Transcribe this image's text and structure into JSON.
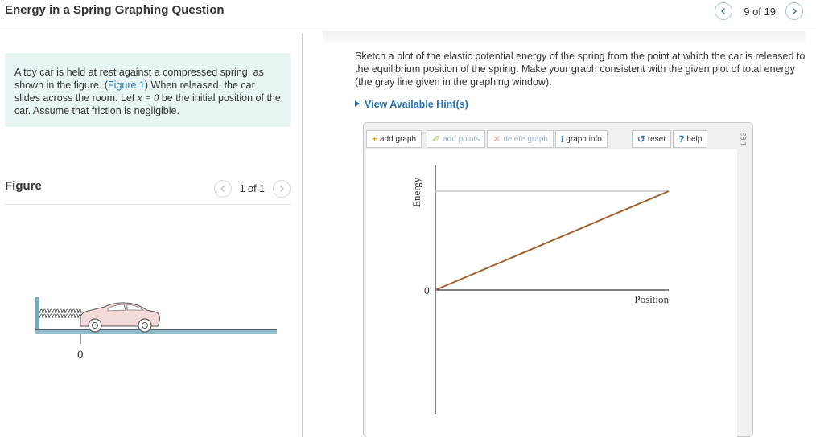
{
  "header": {
    "title": "Energy in a Spring Graphing Question",
    "position": "9 of 19"
  },
  "problem": {
    "part1": "A toy car is held at rest against a compressed spring, as shown in the figure. (",
    "figure_link": "Figure 1",
    "part2": ") When released, the car slides across the room. Let ",
    "math": "x = 0",
    "part3": " be the initial position of the car. Assume that friction is negligible."
  },
  "figure_panel": {
    "title": "Figure",
    "position": "1 of 1",
    "axis_label": "0"
  },
  "question": {
    "prompt": "Sketch a plot of the elastic potential energy of the spring from the point at which the car is released to the equilibrium position of the spring. Make your graph consistent with the given plot of total energy (the gray line given in the graphing window).",
    "hints_label": "View Available Hint(s)"
  },
  "toolbar": {
    "add_graph": "add graph",
    "add_points": "add points",
    "delete_graph": "delete graph",
    "graph_info": "graph info",
    "reset": "reset",
    "help": "help",
    "side_label": "1.53"
  },
  "graph": {
    "y_label": "Energy",
    "x_label": "Position",
    "origin_label": "0"
  },
  "colors": {
    "accent": "#2673b5",
    "panel_bg": "#e7f5f5",
    "total_energy_line": "#c8c8c8",
    "student_line": "#a0612b"
  }
}
